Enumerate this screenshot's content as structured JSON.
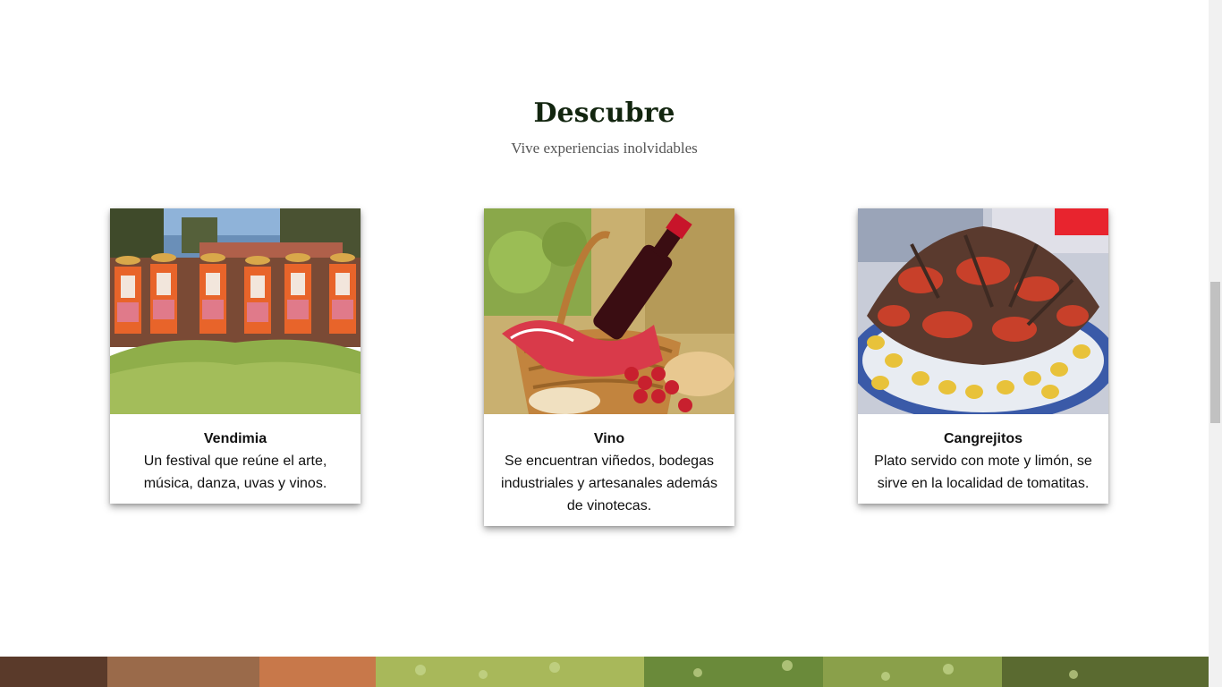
{
  "section": {
    "title": "Descubre",
    "subtitle": "Vive experiencias inolvidables"
  },
  "cards": [
    {
      "title": "Vendimia",
      "text": "Un festival que reúne el arte, música, danza, uvas y vinos.",
      "image_icon": "festival-photo"
    },
    {
      "title": "Vino",
      "text": "Se encuentran viñedos, bodegas industriales y artesanales además de vinotecas.",
      "image_icon": "wine-basket-photo"
    },
    {
      "title": "Cangrejitos",
      "text": "Plato servido con mote y limón, se sirve en la localidad de tomatitas.",
      "image_icon": "crayfish-dish-photo"
    }
  ],
  "colors": {
    "title": "#12250f",
    "subtitle": "#555555",
    "card_text": "#111111"
  }
}
